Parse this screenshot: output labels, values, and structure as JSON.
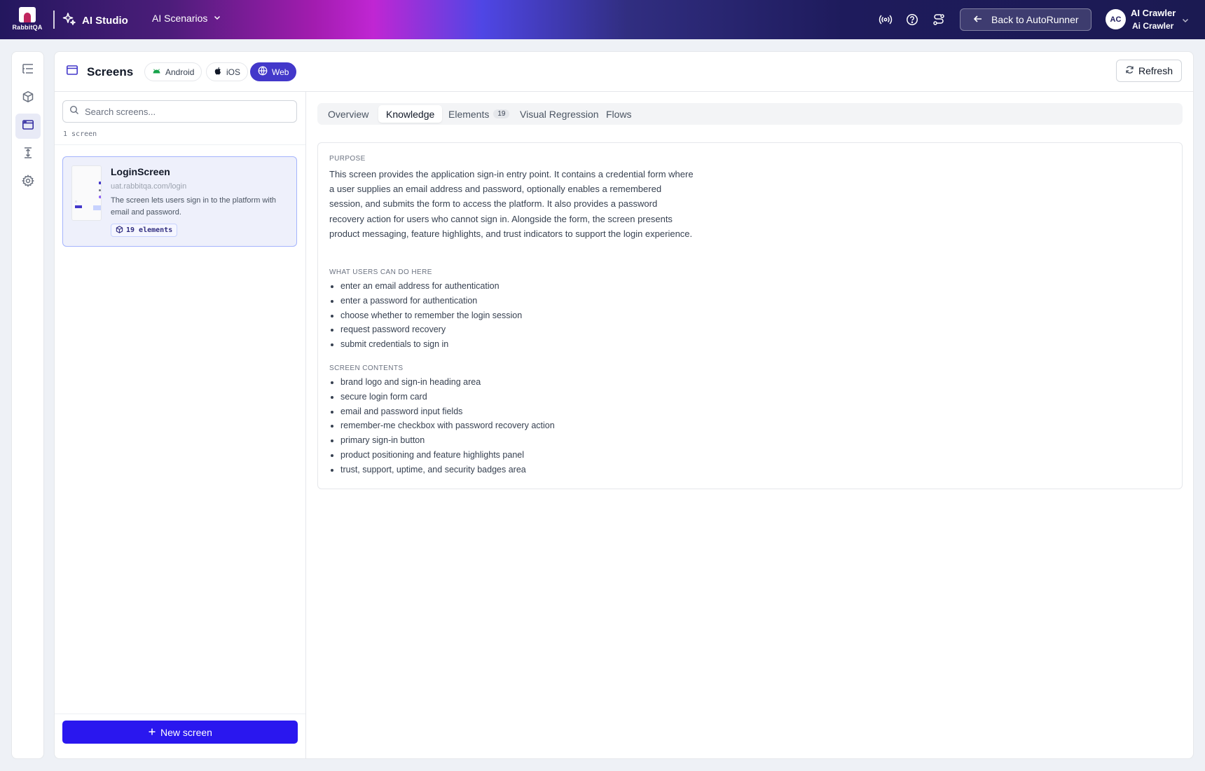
{
  "topbar": {
    "logo_text": "RabbitQA",
    "app_name": "AI Studio",
    "scenarios_menu": "AI Scenarios",
    "back_button": "Back to AutoRunner",
    "user_initials": "AC",
    "user_name": "AI Crawler",
    "user_org": "Ai Crawler",
    "icons": [
      "broadcast-icon",
      "help-circle-icon",
      "route-icon"
    ]
  },
  "rail": {
    "items": [
      {
        "icon": "list-tree-icon",
        "active": false
      },
      {
        "icon": "box-icon",
        "active": false
      },
      {
        "icon": "screen-window-icon",
        "active": true
      },
      {
        "icon": "arrows-vertical-icon",
        "active": false
      },
      {
        "icon": "gear-icon",
        "active": false
      }
    ]
  },
  "header": {
    "title": "Screens",
    "platforms": [
      {
        "label": "Android",
        "active": false
      },
      {
        "label": "iOS",
        "active": false
      },
      {
        "label": "Web",
        "active": true
      }
    ],
    "refresh_label": "Refresh"
  },
  "screen_list": {
    "search_placeholder": "Search screens...",
    "count_text": "1 screen",
    "items": [
      {
        "title": "LoginScreen",
        "url": "uat.rabbitqa.com/login",
        "description": "The screen lets users sign in to the platform with email and password.",
        "elements_badge": "19 elements",
        "selected": true
      }
    ],
    "new_button": "New screen"
  },
  "tabs": [
    {
      "label": "Overview",
      "active": false
    },
    {
      "label": "Knowledge",
      "active": true
    },
    {
      "label": "Elements",
      "count": "19",
      "active": false
    },
    {
      "label": "Visual Regression",
      "active": false
    },
    {
      "label": "Flows",
      "active": false
    }
  ],
  "knowledge": {
    "purpose_label": "PURPOSE",
    "purpose_text": "This screen provides the application sign-in entry point. It contains a credential form where a user supplies an email address and password, optionally enables a remembered session, and submits the form to access the platform. It also provides a password recovery action for users who cannot sign in. Alongside the form, the screen presents product messaging, feature highlights, and trust indicators to support the login experience.",
    "actions_label": "WHAT USERS CAN DO HERE",
    "actions": [
      "enter an email address for authentication",
      "enter a password for authentication",
      "choose whether to remember the login session",
      "request password recovery",
      "submit credentials to sign in"
    ],
    "contents_label": "SCREEN CONTENTS",
    "contents": [
      "brand logo and sign-in heading area",
      "secure login form card",
      "email and password input fields",
      "remember-me checkbox with password recovery action",
      "primary sign-in button",
      "product positioning and feature highlights panel",
      "trust, support, uptime, and security badges area"
    ]
  },
  "colors": {
    "accent": "#4338ca",
    "primary_button": "#2a17ef",
    "selected_card_bg": "#eef0fb"
  }
}
